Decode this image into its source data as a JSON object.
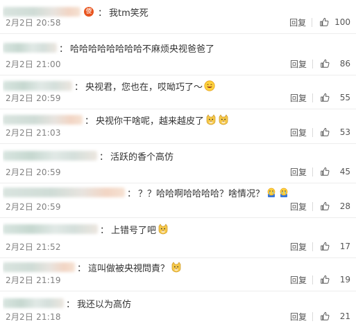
{
  "comments": [
    {
      "text": "我tm笑死",
      "badge": "傻",
      "time": "2月2日 20:58",
      "reply": "回复",
      "likes": "100"
    },
    {
      "text": "哈哈哈哈哈哈哈哈不麻烦央视爸爸了",
      "time": "2月2日 21:00",
      "reply": "回复",
      "likes": "86"
    },
    {
      "text": "央视君，您也在，哎呦巧了～",
      "emoji": "smile-emoji",
      "time": "2月2日 20:59",
      "reply": "回复",
      "likes": "55"
    },
    {
      "text": "央视你干啥呢，越来越皮了",
      "emoji": "doge-emoji",
      "time": "2月2日 21:03",
      "reply": "回复",
      "likes": "53"
    },
    {
      "text": "活跃的香个高仿",
      "time": "2月2日 20:59",
      "reply": "回复",
      "likes": "45"
    },
    {
      "text": "？？哈哈啊哈哈哈哈？啥情况？",
      "emoji": "crying-emoji",
      "time": "2月2日 20:59",
      "reply": "回复",
      "likes": "28"
    },
    {
      "text": "上错号了吧",
      "emoji": "doge-emoji",
      "time": "2月2日 21:52",
      "reply": "回复",
      "likes": "17"
    },
    {
      "text": "這叫做被央視問責？",
      "emoji": "doge-emoji",
      "time": "2月2日 21:19",
      "reply": "回复",
      "likes": "19"
    },
    {
      "text": "我还以为高仿",
      "time": "2月2日 21:18",
      "reply": "回复",
      "likes": "21"
    }
  ],
  "colon": "："
}
